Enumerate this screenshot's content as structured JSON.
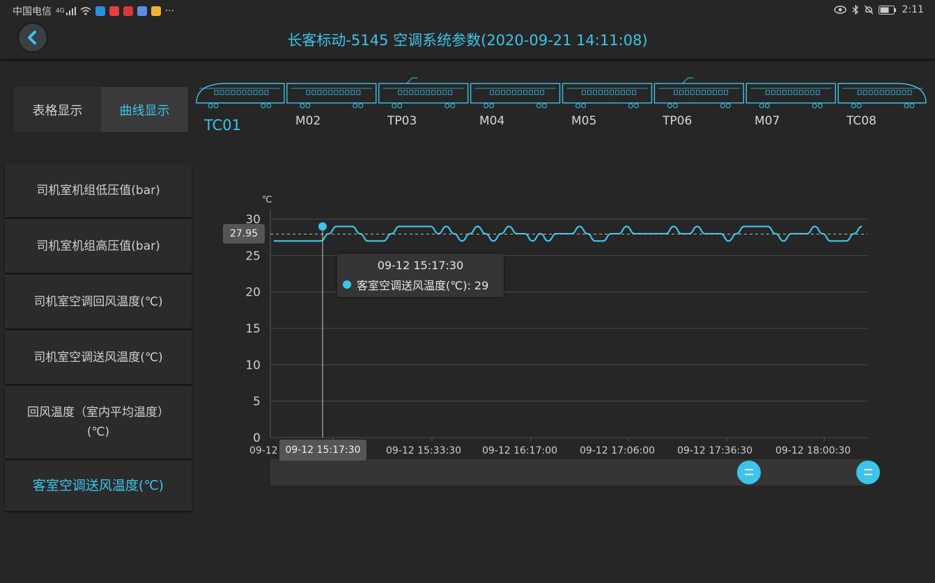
{
  "status": {
    "carrier": "中国电信",
    "net": "4G",
    "more": "···",
    "time": "2:11"
  },
  "header": {
    "title": "长客标动-5145 空调系统参数(2020-09-21 14:11:08)"
  },
  "tabs": [
    {
      "label": "表格显示"
    },
    {
      "label": "曲线显示"
    }
  ],
  "cars": [
    {
      "label": "TC01"
    },
    {
      "label": "M02"
    },
    {
      "label": "TP03"
    },
    {
      "label": "M04"
    },
    {
      "label": "M05"
    },
    {
      "label": "TP06"
    },
    {
      "label": "M07"
    },
    {
      "label": "TC08"
    }
  ],
  "menu": [
    {
      "label": "司机室机组低压值(bar)"
    },
    {
      "label": "司机室机组高压值(bar)"
    },
    {
      "label": "司机室空调回风温度(℃)"
    },
    {
      "label": "司机室空调送风温度(℃)"
    },
    {
      "label": "回风温度（室内平均温度）(℃)"
    },
    {
      "label": "客室空调送风温度(℃)"
    }
  ],
  "colors": {
    "accent": "#3cc4ea",
    "bg": "#262626"
  },
  "tooltip": {
    "time": "09-12 15:17:30",
    "series_value": "客室空调送风温度(℃): 29"
  },
  "crosshair": {
    "y_label": "27.95",
    "x_label": "09-12 15:17:30"
  },
  "chart_data": {
    "type": "line",
    "unit": "℃",
    "ylim": [
      0,
      30
    ],
    "yticks": [
      "0",
      "5",
      "10",
      "15",
      "20",
      "25",
      "30"
    ],
    "xticks": [
      "09-12",
      "09-12 15:33:30",
      "09-12 16:17:00",
      "09-12 17:06:00",
      "09-12 17:36:30",
      "09-12 18:00:30"
    ],
    "grid": true,
    "series": [
      {
        "values": [
          27,
          27,
          27,
          27,
          27,
          27,
          27,
          28,
          29,
          29,
          29,
          28,
          27,
          27,
          27,
          28,
          29,
          29,
          29,
          29,
          29,
          28,
          29,
          28,
          27,
          28,
          29,
          28,
          27,
          28,
          29,
          28,
          28,
          27,
          28,
          27,
          28,
          28,
          28,
          29,
          28,
          27,
          27,
          28,
          28,
          29,
          28,
          28,
          28,
          28,
          28,
          29,
          28,
          28,
          29,
          28,
          28,
          28,
          27,
          28,
          29,
          29,
          29,
          29,
          28,
          27,
          28,
          28,
          28,
          29,
          28,
          27,
          27,
          27,
          28,
          29
        ]
      }
    ]
  }
}
